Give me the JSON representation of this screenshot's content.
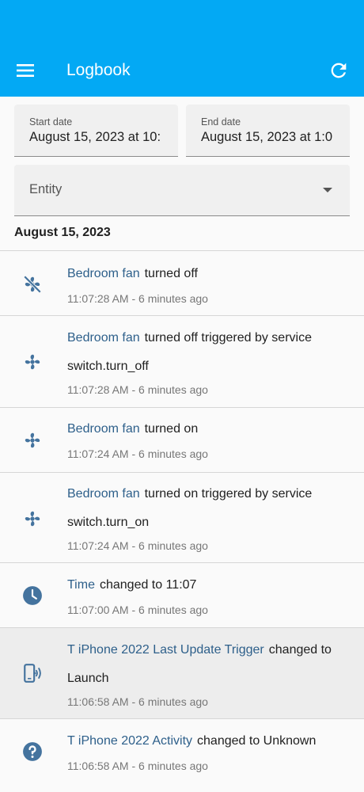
{
  "appbar": {
    "title": "Logbook"
  },
  "filters": {
    "start_label": "Start date",
    "start_value": "August 15, 2023 at 10:",
    "end_label": "End date",
    "end_value": "August 15, 2023 at 1:0",
    "entity_label": "Entity"
  },
  "date_header": "August 15, 2023",
  "entries": [
    {
      "icon": "fan-off-icon",
      "entity": "Bedroom fan",
      "message": "turned off",
      "time": "11:07:28 AM - 6 minutes ago"
    },
    {
      "icon": "fan-icon",
      "entity": "Bedroom fan",
      "message": "turned off triggered by service switch.turn_off",
      "time": "11:07:28 AM - 6 minutes ago"
    },
    {
      "icon": "fan-icon",
      "entity": "Bedroom fan",
      "message": "turned on",
      "time": "11:07:24 AM - 6 minutes ago"
    },
    {
      "icon": "fan-icon",
      "entity": "Bedroom fan",
      "message": "turned on triggered by service switch.turn_on",
      "time": "11:07:24 AM - 6 minutes ago"
    },
    {
      "icon": "clock-icon",
      "entity": "Time",
      "message": "changed to 11:07",
      "time": "11:07:00 AM - 6 minutes ago"
    },
    {
      "icon": "phone-wireless-icon",
      "entity": "T iPhone 2022 Last Update Trigger",
      "message": "changed to Launch",
      "time": "11:06:58 AM - 6 minutes ago"
    },
    {
      "icon": "help-circle-icon",
      "entity": "T iPhone 2022 Activity",
      "message": "changed to Unknown",
      "time": "11:06:58 AM - 6 minutes ago"
    }
  ],
  "colors": {
    "primary": "#03a9f4",
    "icon": "#44739e",
    "entity_link": "#2d5f8a"
  }
}
